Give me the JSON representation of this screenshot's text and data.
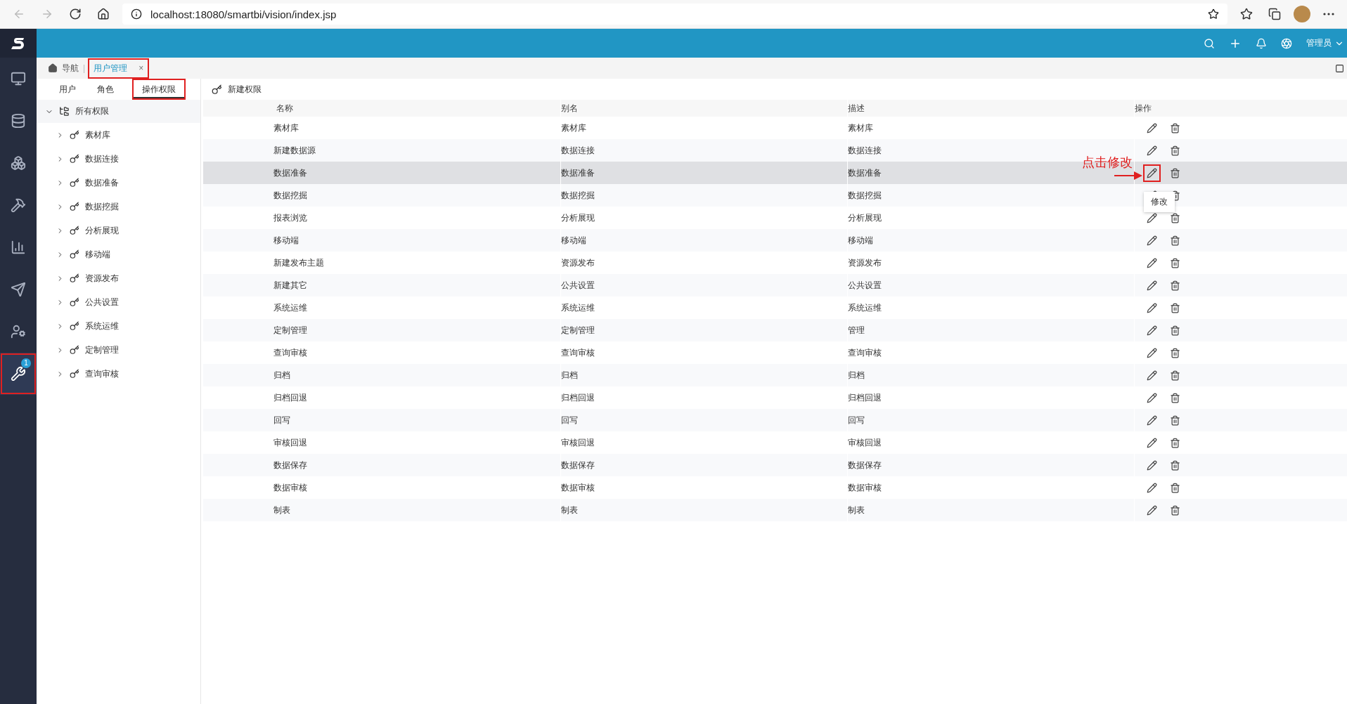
{
  "browser": {
    "url": "localhost:18080/smartbi/vision/index.jsp"
  },
  "header": {
    "user": "管理员"
  },
  "sidebar": {
    "items": [
      {
        "kind": "monitor",
        "selected": false,
        "highlighted": false
      },
      {
        "kind": "database",
        "selected": false,
        "highlighted": false
      },
      {
        "kind": "cubes",
        "selected": false,
        "highlighted": false
      },
      {
        "kind": "tool",
        "selected": false,
        "highlighted": false
      },
      {
        "kind": "chart",
        "selected": false,
        "highlighted": false
      },
      {
        "kind": "plane",
        "selected": false,
        "highlighted": false
      },
      {
        "kind": "person",
        "selected": false,
        "highlighted": false
      },
      {
        "kind": "tools",
        "selected": true,
        "highlighted": true,
        "badge": "1"
      }
    ]
  },
  "breadcrumb": {
    "home": "导航",
    "separator": "|",
    "tabs": [
      {
        "label": "用户管理",
        "selected": true,
        "highlighted": true,
        "close": "×"
      }
    ]
  },
  "subtabs": [
    {
      "label": "用户",
      "selected": false,
      "highlighted": false
    },
    {
      "label": "角色",
      "selected": false,
      "highlighted": false
    },
    {
      "label": "操作权限",
      "selected": true,
      "highlighted": true
    }
  ],
  "toolbar": {
    "new_button": "新建权限"
  },
  "tree": {
    "label": "所有权限",
    "expanded": true,
    "children": [
      {
        "label": "素材库",
        "expanded": false
      },
      {
        "label": "数据连接",
        "expanded": false
      },
      {
        "label": "数据准备",
        "expanded": false
      },
      {
        "label": "数据挖掘",
        "expanded": false
      },
      {
        "label": "分析展现",
        "expanded": false
      },
      {
        "label": "移动端",
        "expanded": false
      },
      {
        "label": "资源发布",
        "expanded": false
      },
      {
        "label": "公共设置",
        "expanded": false
      },
      {
        "label": "系统运维",
        "expanded": false
      },
      {
        "label": "定制管理",
        "expanded": false
      },
      {
        "label": "查询审核",
        "expanded": false
      }
    ]
  },
  "table": {
    "columns": [
      "名称",
      "别名",
      "描述",
      "操作"
    ],
    "rows": [
      {
        "name": "素材库",
        "alias": "素材库",
        "description": "素材库",
        "selected": false
      },
      {
        "name": "新建数据源",
        "alias": "数据连接",
        "description": "数据连接",
        "selected": false
      },
      {
        "name": "数据准备",
        "alias": "数据准备",
        "description": "数据准备",
        "selected": true,
        "annotation": "点击修改",
        "edit_highlighted": true,
        "tooltip": "修改"
      },
      {
        "name": "数据挖掘",
        "alias": "数据挖掘",
        "description": "数据挖掘",
        "selected": false
      },
      {
        "name": "报表浏览",
        "alias": "分析展现",
        "description": "分析展现",
        "selected": false
      },
      {
        "name": "移动端",
        "alias": "移动端",
        "description": "移动端",
        "selected": false
      },
      {
        "name": "新建发布主题",
        "alias": "资源发布",
        "description": "资源发布",
        "selected": false
      },
      {
        "name": "新建其它",
        "alias": "公共设置",
        "description": "公共设置",
        "selected": false
      },
      {
        "name": "系统运维",
        "alias": "系统运维",
        "description": "系统运维",
        "selected": false
      },
      {
        "name": "定制管理",
        "alias": "定制管理",
        "description": "管理",
        "selected": false
      },
      {
        "name": "查询审核",
        "alias": "查询审核",
        "description": "查询审核",
        "selected": false
      },
      {
        "name": "归档",
        "alias": "归档",
        "description": "归档",
        "selected": false
      },
      {
        "name": "归档回退",
        "alias": "归档回退",
        "description": "归档回退",
        "selected": false
      },
      {
        "name": "回写",
        "alias": "回写",
        "description": "回写",
        "selected": false
      },
      {
        "name": "审核回退",
        "alias": "审核回退",
        "description": "审核回退",
        "selected": false
      },
      {
        "name": "数据保存",
        "alias": "数据保存",
        "description": "数据保存",
        "selected": false
      },
      {
        "name": "数据审核",
        "alias": "数据审核",
        "description": "数据审核",
        "selected": false
      },
      {
        "name": "制表",
        "alias": "制表",
        "description": "制表",
        "selected": false
      }
    ]
  }
}
